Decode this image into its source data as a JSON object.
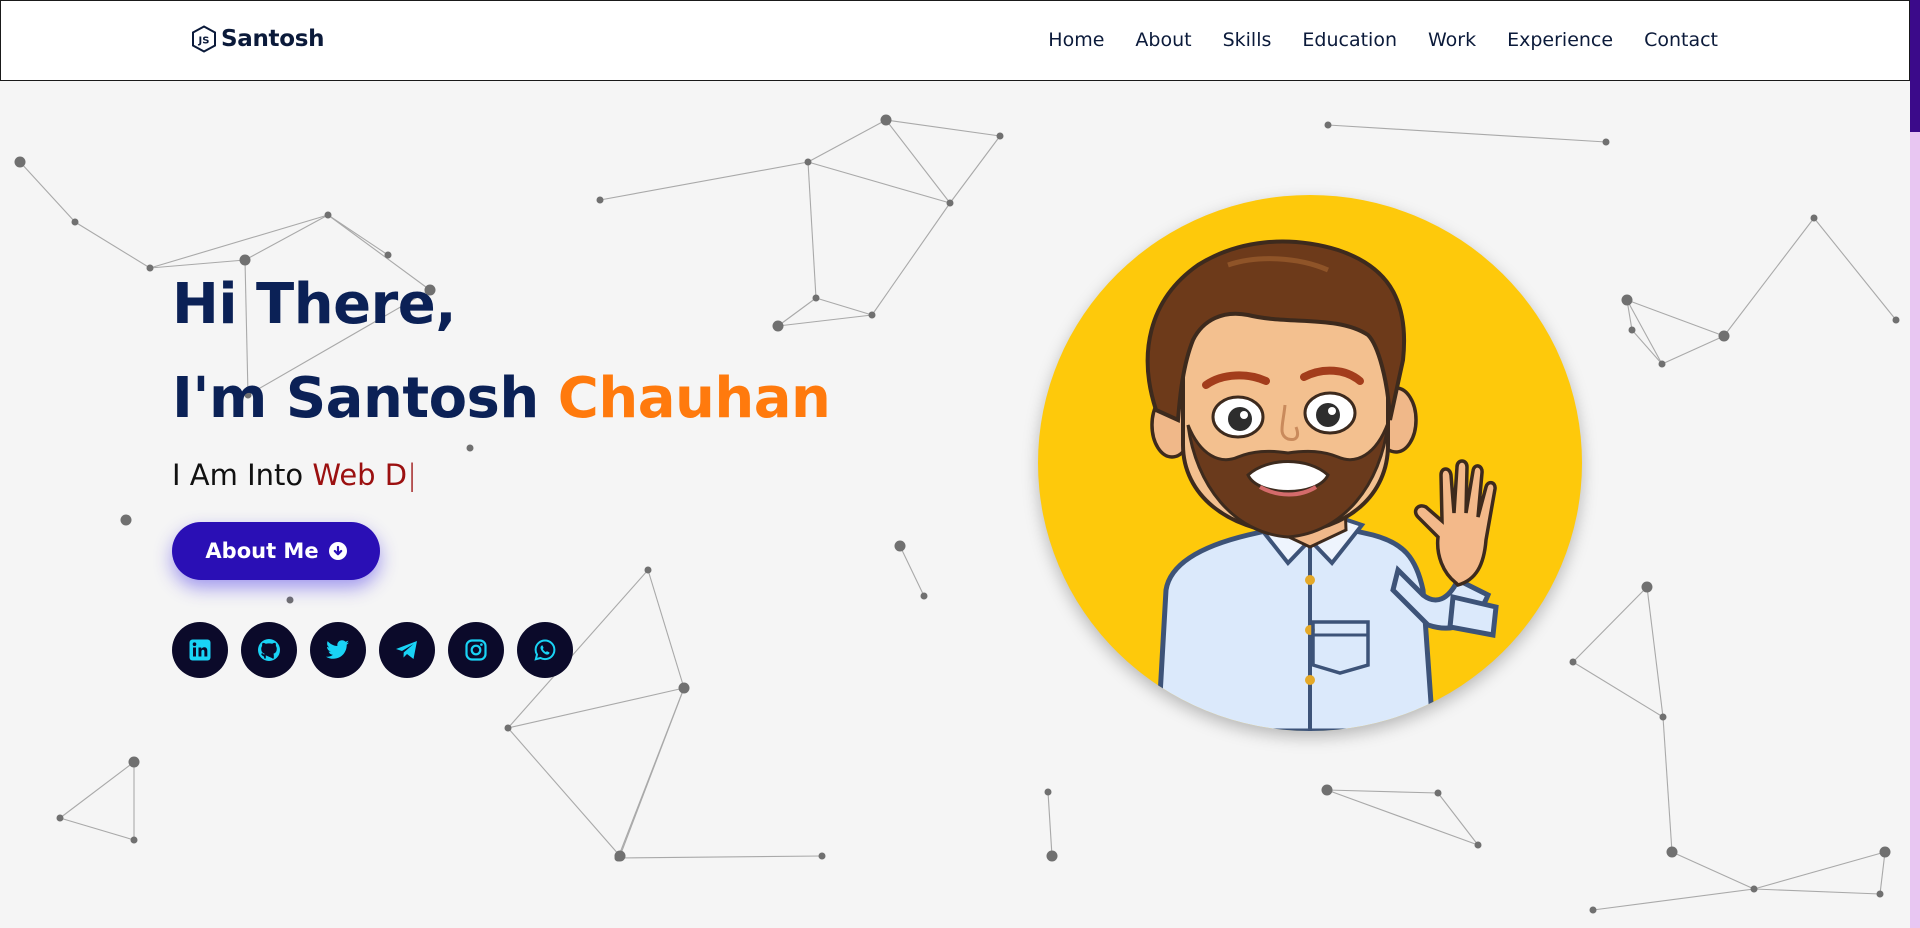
{
  "brand": {
    "name": "Santosh",
    "icon": "nodejs-hexagon-icon"
  },
  "nav": {
    "items": [
      "Home",
      "About",
      "Skills",
      "Education",
      "Work",
      "Experience",
      "Contact"
    ]
  },
  "hero": {
    "greeting": "Hi There,",
    "intro_prefix": "I'm Santosh",
    "intro_last": "Chauhan",
    "typed_prefix": "I Am Into",
    "typed_value": "Web D",
    "typed_cursor": "|",
    "button_label": "About Me",
    "button_icon": "arrow-down-circle-icon"
  },
  "socials": [
    {
      "name": "linkedin-icon"
    },
    {
      "name": "github-icon"
    },
    {
      "name": "twitter-icon"
    },
    {
      "name": "telegram-icon"
    },
    {
      "name": "instagram-icon"
    },
    {
      "name": "whatsapp-icon"
    }
  ],
  "colors": {
    "heading": "#0b2156",
    "accent_orange": "#ff7a0d",
    "typed_red": "#9b1010",
    "button": "#2a0fb5",
    "social_bg": "#0b0a2a",
    "social_icon": "#19d3f5",
    "avatar_bg": "#fec90b",
    "page_bg": "#f5f5f5"
  }
}
